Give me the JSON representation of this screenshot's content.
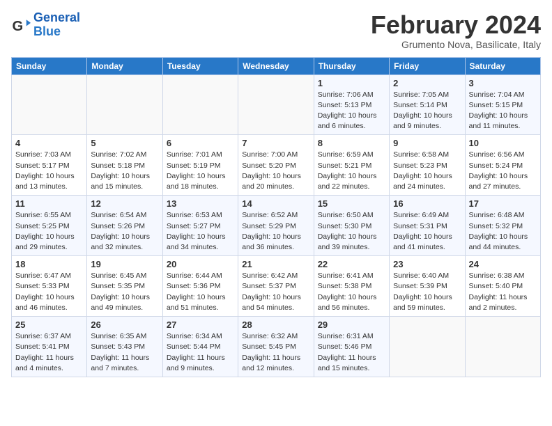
{
  "header": {
    "logo_line1": "General",
    "logo_line2": "Blue",
    "month_title": "February 2024",
    "location": "Grumento Nova, Basilicate, Italy"
  },
  "days_of_week": [
    "Sunday",
    "Monday",
    "Tuesday",
    "Wednesday",
    "Thursday",
    "Friday",
    "Saturday"
  ],
  "weeks": [
    [
      {
        "day": "",
        "info": ""
      },
      {
        "day": "",
        "info": ""
      },
      {
        "day": "",
        "info": ""
      },
      {
        "day": "",
        "info": ""
      },
      {
        "day": "1",
        "info": "Sunrise: 7:06 AM\nSunset: 5:13 PM\nDaylight: 10 hours\nand 6 minutes."
      },
      {
        "day": "2",
        "info": "Sunrise: 7:05 AM\nSunset: 5:14 PM\nDaylight: 10 hours\nand 9 minutes."
      },
      {
        "day": "3",
        "info": "Sunrise: 7:04 AM\nSunset: 5:15 PM\nDaylight: 10 hours\nand 11 minutes."
      }
    ],
    [
      {
        "day": "4",
        "info": "Sunrise: 7:03 AM\nSunset: 5:17 PM\nDaylight: 10 hours\nand 13 minutes."
      },
      {
        "day": "5",
        "info": "Sunrise: 7:02 AM\nSunset: 5:18 PM\nDaylight: 10 hours\nand 15 minutes."
      },
      {
        "day": "6",
        "info": "Sunrise: 7:01 AM\nSunset: 5:19 PM\nDaylight: 10 hours\nand 18 minutes."
      },
      {
        "day": "7",
        "info": "Sunrise: 7:00 AM\nSunset: 5:20 PM\nDaylight: 10 hours\nand 20 minutes."
      },
      {
        "day": "8",
        "info": "Sunrise: 6:59 AM\nSunset: 5:21 PM\nDaylight: 10 hours\nand 22 minutes."
      },
      {
        "day": "9",
        "info": "Sunrise: 6:58 AM\nSunset: 5:23 PM\nDaylight: 10 hours\nand 24 minutes."
      },
      {
        "day": "10",
        "info": "Sunrise: 6:56 AM\nSunset: 5:24 PM\nDaylight: 10 hours\nand 27 minutes."
      }
    ],
    [
      {
        "day": "11",
        "info": "Sunrise: 6:55 AM\nSunset: 5:25 PM\nDaylight: 10 hours\nand 29 minutes."
      },
      {
        "day": "12",
        "info": "Sunrise: 6:54 AM\nSunset: 5:26 PM\nDaylight: 10 hours\nand 32 minutes."
      },
      {
        "day": "13",
        "info": "Sunrise: 6:53 AM\nSunset: 5:27 PM\nDaylight: 10 hours\nand 34 minutes."
      },
      {
        "day": "14",
        "info": "Sunrise: 6:52 AM\nSunset: 5:29 PM\nDaylight: 10 hours\nand 36 minutes."
      },
      {
        "day": "15",
        "info": "Sunrise: 6:50 AM\nSunset: 5:30 PM\nDaylight: 10 hours\nand 39 minutes."
      },
      {
        "day": "16",
        "info": "Sunrise: 6:49 AM\nSunset: 5:31 PM\nDaylight: 10 hours\nand 41 minutes."
      },
      {
        "day": "17",
        "info": "Sunrise: 6:48 AM\nSunset: 5:32 PM\nDaylight: 10 hours\nand 44 minutes."
      }
    ],
    [
      {
        "day": "18",
        "info": "Sunrise: 6:47 AM\nSunset: 5:33 PM\nDaylight: 10 hours\nand 46 minutes."
      },
      {
        "day": "19",
        "info": "Sunrise: 6:45 AM\nSunset: 5:35 PM\nDaylight: 10 hours\nand 49 minutes."
      },
      {
        "day": "20",
        "info": "Sunrise: 6:44 AM\nSunset: 5:36 PM\nDaylight: 10 hours\nand 51 minutes."
      },
      {
        "day": "21",
        "info": "Sunrise: 6:42 AM\nSunset: 5:37 PM\nDaylight: 10 hours\nand 54 minutes."
      },
      {
        "day": "22",
        "info": "Sunrise: 6:41 AM\nSunset: 5:38 PM\nDaylight: 10 hours\nand 56 minutes."
      },
      {
        "day": "23",
        "info": "Sunrise: 6:40 AM\nSunset: 5:39 PM\nDaylight: 10 hours\nand 59 minutes."
      },
      {
        "day": "24",
        "info": "Sunrise: 6:38 AM\nSunset: 5:40 PM\nDaylight: 11 hours\nand 2 minutes."
      }
    ],
    [
      {
        "day": "25",
        "info": "Sunrise: 6:37 AM\nSunset: 5:41 PM\nDaylight: 11 hours\nand 4 minutes."
      },
      {
        "day": "26",
        "info": "Sunrise: 6:35 AM\nSunset: 5:43 PM\nDaylight: 11 hours\nand 7 minutes."
      },
      {
        "day": "27",
        "info": "Sunrise: 6:34 AM\nSunset: 5:44 PM\nDaylight: 11 hours\nand 9 minutes."
      },
      {
        "day": "28",
        "info": "Sunrise: 6:32 AM\nSunset: 5:45 PM\nDaylight: 11 hours\nand 12 minutes."
      },
      {
        "day": "29",
        "info": "Sunrise: 6:31 AM\nSunset: 5:46 PM\nDaylight: 11 hours\nand 15 minutes."
      },
      {
        "day": "",
        "info": ""
      },
      {
        "day": "",
        "info": ""
      }
    ]
  ]
}
